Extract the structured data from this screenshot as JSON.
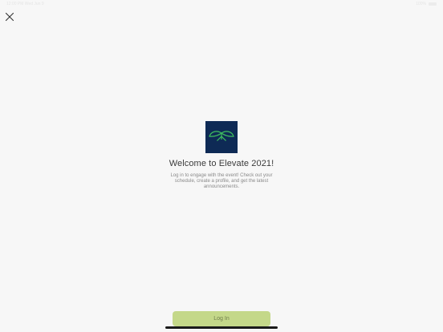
{
  "status_bar": {
    "left_text": "12:00 PM   Wed Jun 9",
    "battery_text": "100%"
  },
  "icons": {
    "close": "close-icon",
    "logo": "leaf-wings-logo"
  },
  "welcome": {
    "title": "Welcome to Elevate 2021!",
    "description": "Log in to engage with the event! Check out your schedule, create a profile, and get the latest announcements."
  },
  "actions": {
    "login_label": "Log In"
  },
  "colors": {
    "logo_background": "#0e2a55",
    "logo_accent": "#3fbf5f",
    "login_button": "#c4d889",
    "login_text": "#6f7d4c"
  }
}
